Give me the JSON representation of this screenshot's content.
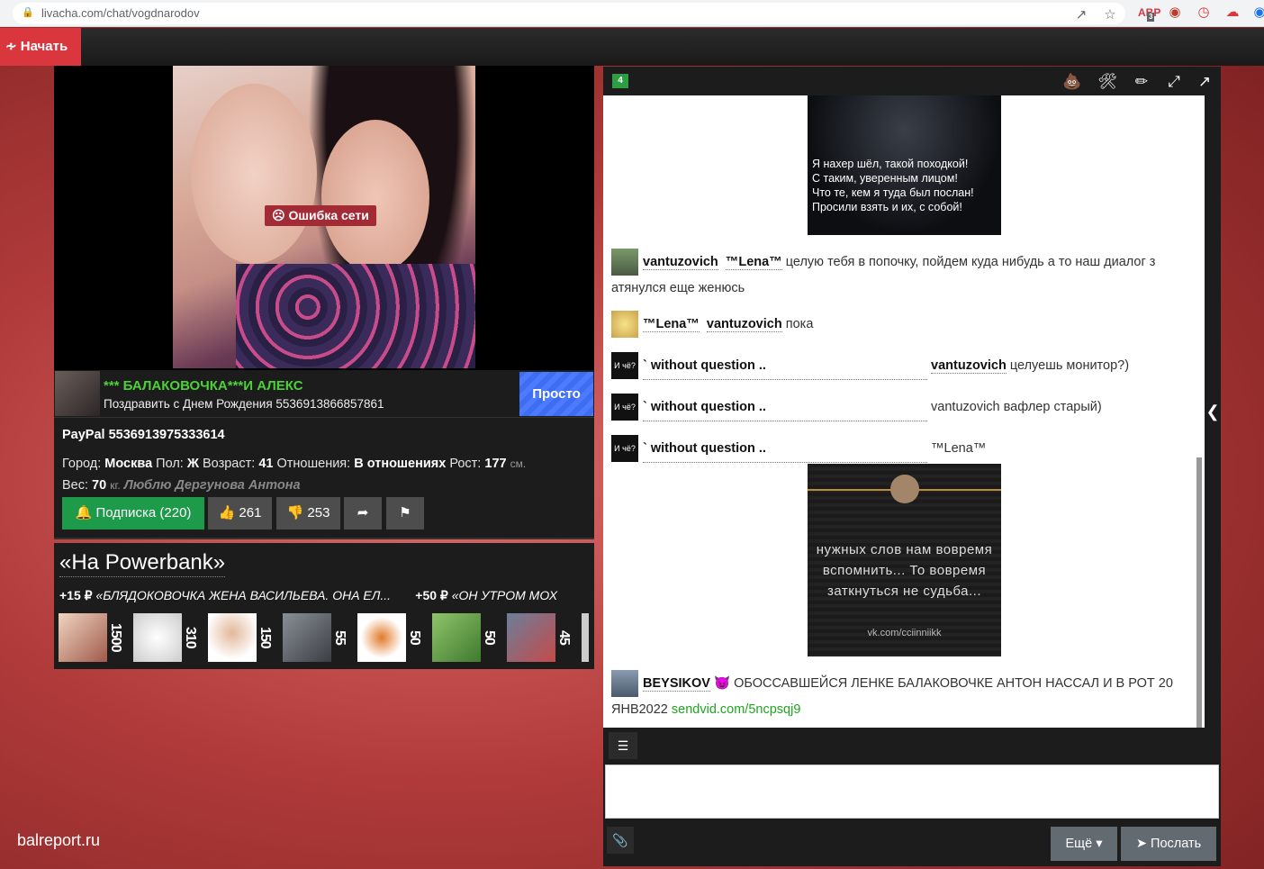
{
  "browser": {
    "url": "livacha.com/chat/vogdnarodov",
    "adblock_count": "3"
  },
  "nav": {
    "start_label": "Начать"
  },
  "video": {
    "error_label": "Ошибка сети"
  },
  "profile": {
    "title": "*** БАЛАКОВОЧКА***И АЛЕКС",
    "subtitle": "Поздравить с Днем Рождения 5536913866857861",
    "status_button": "Просто",
    "paypal": "PayPal 5536913975333614",
    "city_label": "Город:",
    "city": "Москва",
    "sex_label": "Пол:",
    "sex": "Ж",
    "age_label": "Возраст:",
    "age": "41",
    "rel_label": "Отношения:",
    "rel": "В отношениях",
    "height_label": "Рост:",
    "height": "177",
    "height_unit": "см.",
    "weight_label": "Вес:",
    "weight": "70",
    "weight_unit": "кг.",
    "note": "Люблю Дергунова Антона",
    "subscribe_label": "Подписка (220)",
    "likes": "261",
    "dislikes": "253"
  },
  "goal": {
    "title": "«На Powerbank»",
    "ticker": [
      {
        "amount": "+15 ₽",
        "text": "«БЛЯДОКОВОЧКА ЖЕНА ВАСИЛЬЕВА. ОНА ЕЛ..."
      },
      {
        "amount": "+50 ₽",
        "text": "«ОН УТРОМ МОХ"
      }
    ],
    "donors": [
      "1500",
      "310",
      "150",
      "55",
      "50",
      "50",
      "45"
    ]
  },
  "chat": {
    "badge": "4",
    "meme1_text": "Я нахер шёл, такой походкой!\nС таким, уверенным лицом!\nЧто те, кем я туда был послан!\nПросили взять и их, с собой!",
    "messages": [
      {
        "from": "vantuzovich",
        "to": "™Lena™",
        "text": "целую тебя в попочку, пойдем куда нибудь а то наш диалог з",
        "text2": "атянулся еще женюсь"
      },
      {
        "from": "™Lena™",
        "to": "vantuzovich",
        "text": "пока"
      },
      {
        "avatar": "И чё?",
        "from": "` without question ..",
        "to": "vantuzovich",
        "text": "целуешь монитор?)"
      },
      {
        "avatar": "И чё?",
        "from": "` without question ..",
        "text": "vantuzovich вафлер старый)"
      },
      {
        "avatar": "И чё?",
        "from": "` without question ..",
        "text": "™Lena™"
      },
      {
        "from": "BEYSIKOV",
        "text": "ОБОССАВШЕЙСЯ ЛЕНКЕ БАЛАКОВОЧКЕ АНТОН НАССАЛ И В РОТ 20",
        "text2": "ЯНВ2022",
        "link": "sendvid.com/5ncpsqj9"
      }
    ],
    "meme2_text": "нужных слов нам вовремя\nвспомнить... То вовремя\nзаткнуться не судьба...",
    "meme2_sig": "vk.com/cciinniikk",
    "more_label": "Ещё",
    "send_label": "Послать"
  },
  "watermark": "balreport.ru",
  "colors": {
    "accent_red": "#d9363e",
    "nick_green": "#4cd137",
    "subscribe_green": "#1e9a4b",
    "prosto_blue": "#3d6df2"
  }
}
